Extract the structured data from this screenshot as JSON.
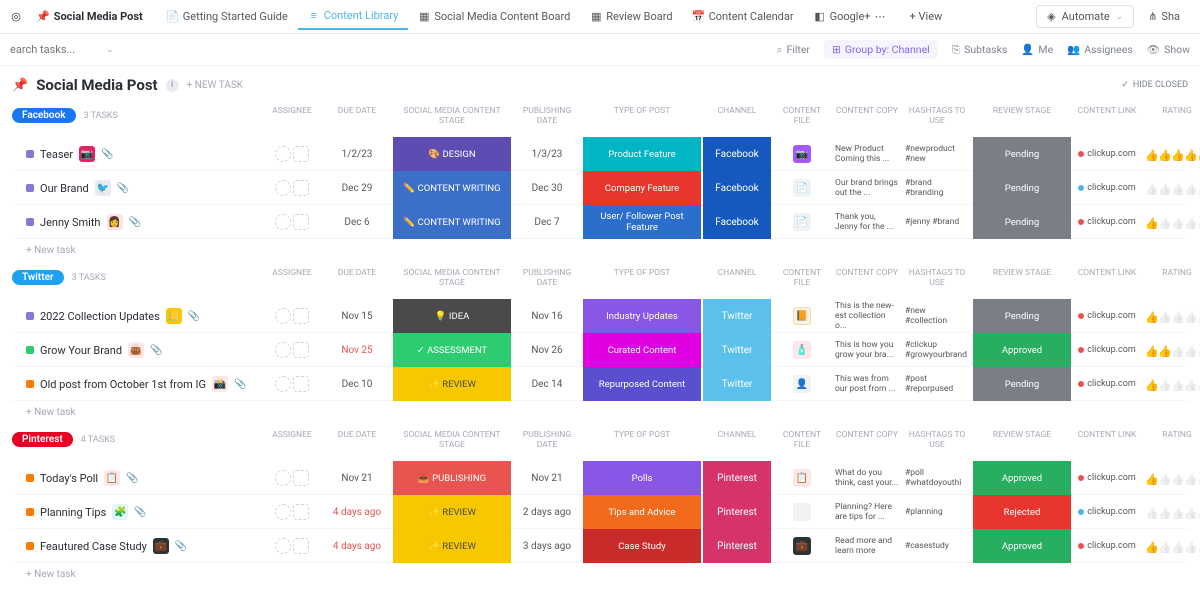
{
  "nav": {
    "brand_icon": "◎",
    "main": {
      "pin": "📌",
      "label": "Social Media Post"
    },
    "items": [
      {
        "icon": "📄",
        "label": "Getting Started Guide"
      },
      {
        "icon": "≡",
        "label": "Content Library",
        "active": true
      },
      {
        "icon": "▦",
        "label": "Social Media Content Board"
      },
      {
        "icon": "▦",
        "label": "Review Board"
      },
      {
        "icon": "📅",
        "label": "Content Calendar"
      },
      {
        "icon": "◧",
        "label": "Google+",
        "suffix": "⋯"
      }
    ],
    "view": "+ View",
    "automate": "Automate",
    "share": "Sha"
  },
  "filters": {
    "search_placeholder": "earch tasks...",
    "items": [
      "Filter",
      "Group by: Channel",
      "Subtasks",
      "Me",
      "Assignees",
      "Show"
    ],
    "active_index": 1
  },
  "page": {
    "title": "Social Media Post",
    "newtask": "+ NEW TASK",
    "hide_closed": "HIDE CLOSED"
  },
  "columns": [
    "",
    "ASSIGNEE",
    "DUE DATE",
    "SOCIAL MEDIA CONTENT STAGE",
    "PUBLISHING DATE",
    "TYPE OF POST",
    "CHANNEL",
    "CONTENT FILE",
    "CONTENT COPY",
    "HASHTAGS TO USE",
    "REVIEW STAGE",
    "CONTENT LINK",
    "RATING"
  ],
  "groups": [
    {
      "name": "Facebook",
      "pill_class": "pill-facebook",
      "count": "3 TASKS",
      "tasks": [
        {
          "dot": "#8777d9",
          "name": "Teaser",
          "emoji": "📷",
          "emoji_bg": "#e91e63",
          "due": "1/2/23",
          "due_red": false,
          "stage": "🎨 DESIGN",
          "stage_class": "bg-design",
          "pub": "1/3/23",
          "type": "Product Feature",
          "type_class": "bg-teal",
          "channel": "Facebook",
          "channel_class": "bg-fb",
          "file_class": "file-mag",
          "file_icon": "📷",
          "copy": "New Product Coming this ...",
          "hashtags": "#newproduct #new",
          "review": "Pending",
          "review_class": "bg-pending",
          "link": "clickup.com",
          "link_color": "#e8544f",
          "rating": 5
        },
        {
          "dot": "#8777d9",
          "name": "Our Brand",
          "emoji": "🐦",
          "emoji_bg": "#e9ebf0",
          "due": "Dec 29",
          "due_red": false,
          "stage": "✏️ CONTENT WRITING",
          "stage_class": "bg-writing",
          "pub": "Dec 30",
          "type": "Company Feature",
          "type_class": "bg-red",
          "channel": "Facebook",
          "channel_class": "bg-fb",
          "file_class": "file-doc",
          "file_icon": "📄",
          "copy": "Our brand brings out the ...",
          "hashtags": "#brand #branding",
          "review": "Pending",
          "review_class": "bg-pending",
          "link": "clickup.com",
          "link_color": "#4fb5e8",
          "rating": 0
        },
        {
          "dot": "#8777d9",
          "name": "Jenny Smith",
          "emoji": "👩",
          "emoji_bg": "#fde2e2",
          "due": "Dec 6",
          "due_red": false,
          "stage": "✏️ CONTENT WRITING",
          "stage_class": "bg-writing",
          "pub": "Dec 7",
          "type": "User/ Follower Post Feature",
          "type_class": "bg-blue2",
          "channel": "Facebook",
          "channel_class": "bg-fb",
          "file_class": "file-doc",
          "file_icon": "📄",
          "copy": "Thank you, Jenny for the ...",
          "hashtags": "#jenny #brand",
          "review": "Pending",
          "review_class": "bg-pending",
          "link": "clickup.com",
          "link_color": "#e8544f",
          "rating": 1
        }
      ]
    },
    {
      "name": "Twitter",
      "pill_class": "pill-twitter",
      "count": "3 TASKS",
      "tasks": [
        {
          "dot": "#8777d9",
          "name": "2022 Collection Updates",
          "emoji": "📒",
          "emoji_bg": "#f7c800",
          "due": "Nov 15",
          "due_red": false,
          "stage": "💡 IDEA",
          "stage_class": "bg-idea",
          "pub": "Nov 16",
          "type": "Industry Updates",
          "type_class": "bg-purple",
          "channel": "Twitter",
          "channel_class": "bg-tw",
          "file_class": "file-img",
          "file_icon": "📙",
          "copy": "This is the new-est collection o...",
          "hashtags": "#new #collection",
          "review": "Pending",
          "review_class": "bg-pending",
          "link": "clickup.com",
          "link_color": "#e8544f",
          "rating": 1
        },
        {
          "dot": "#2ecc71",
          "name": "Grow Your Brand",
          "emoji": "👜",
          "emoji_bg": "#fde7e7",
          "due": "Nov 25",
          "due_red": true,
          "stage": "✓ ASSESSMENT",
          "stage_class": "bg-assess",
          "pub": "Nov 26",
          "type": "Curated Content",
          "type_class": "bg-magenta",
          "channel": "Twitter",
          "channel_class": "bg-tw",
          "file_class": "file-misc",
          "file_icon": "🧴",
          "copy": "This is how you grow your bra...",
          "hashtags": "#clickup #growyourbrand",
          "review": "Approved",
          "review_class": "bg-approved",
          "link": "clickup.com",
          "link_color": "#e8544f",
          "rating": 2
        },
        {
          "dot": "#ff7b00",
          "name": "Old post from October 1st from IG",
          "emoji": "📸",
          "emoji_bg": "#fde7e7",
          "due": "Dec 10",
          "due_red": false,
          "stage": "✨ REVIEW",
          "stage_class": "bg-review",
          "pub": "Dec 14",
          "type": "Repurposed Content",
          "type_class": "bg-navy",
          "channel": "Twitter",
          "channel_class": "bg-tw",
          "file_class": "file-doc",
          "file_icon": "👤",
          "copy": "This was from our post from ...",
          "hashtags": "#post #reporpused",
          "review": "Pending",
          "review_class": "bg-pending",
          "link": "clickup.com",
          "link_color": "#e8544f",
          "rating": 1
        }
      ]
    },
    {
      "name": "Pinterest",
      "pill_class": "pill-pinterest",
      "count": "4 TASKS",
      "tasks": [
        {
          "dot": "#ff7b00",
          "name": "Today's Poll",
          "emoji": "📋",
          "emoji_bg": "#fde7e7",
          "due": "Nov 21",
          "due_red": false,
          "stage": "📤 PUBLISHING",
          "stage_class": "bg-publish",
          "pub": "Nov 21",
          "type": "Polls",
          "type_class": "bg-purple",
          "channel": "Pinterest",
          "channel_class": "bg-pin",
          "file_class": "file-misc",
          "file_icon": "📋",
          "copy": "What do you think, cast your...",
          "hashtags": "#poll #whatdoyouthi",
          "review": "Approved",
          "review_class": "bg-approved",
          "link": "clickup.com",
          "link_color": "#e8544f",
          "rating": 1
        },
        {
          "dot": "#ff7b00",
          "name": "Planning Tips",
          "emoji": "🧩",
          "emoji_bg": "#e0f7fa",
          "due": "4 days ago",
          "due_red": true,
          "stage": "✨ REVIEW",
          "stage_class": "bg-review",
          "pub": "2 days ago",
          "type": "Tips and Advice",
          "type_class": "bg-orange",
          "channel": "Pinterest",
          "channel_class": "bg-pin",
          "file_class": "file-doc",
          "file_icon": "",
          "copy": "Planning? Here are tips for ...",
          "hashtags": "#planning",
          "review": "Rejected",
          "review_class": "bg-rejected",
          "link": "clickup.com",
          "link_color": "#4fb5e8",
          "rating": 0
        },
        {
          "dot": "#ff7b00",
          "name": "Feautured Case Study",
          "emoji": "💼",
          "emoji_bg": "#2d3436",
          "due": "4 days ago",
          "due_red": true,
          "stage": "✨ REVIEW",
          "stage_class": "bg-review",
          "pub": "3 days ago",
          "type": "Case Study",
          "type_class": "bg-darkred",
          "channel": "Pinterest",
          "channel_class": "bg-pin",
          "file_class": "file-dark",
          "file_icon": "💼",
          "copy": "Read more and learn more",
          "hashtags": "#casestudy",
          "review": "Approved",
          "review_class": "bg-approved",
          "link": "clickup.com",
          "link_color": "#e8544f",
          "rating": 1
        }
      ]
    }
  ],
  "newtask_label": "+ New task"
}
